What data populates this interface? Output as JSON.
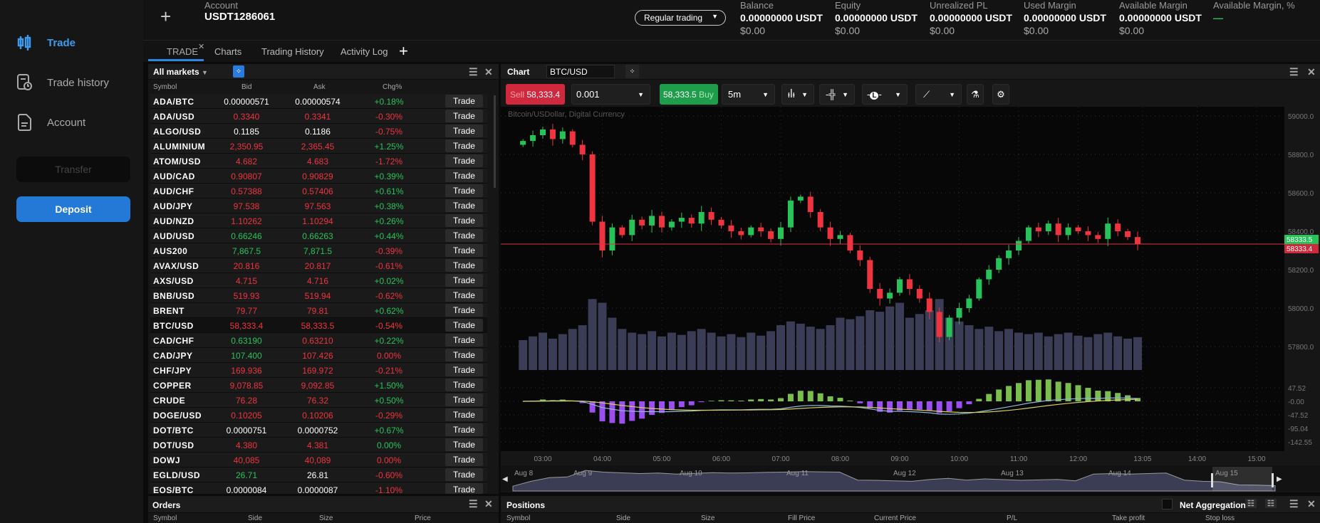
{
  "sidebar": {
    "items": [
      {
        "label": "Trade",
        "icon": "candlestick-icon",
        "active": true
      },
      {
        "label": "Trade history",
        "icon": "history-icon"
      },
      {
        "label": "Account",
        "icon": "document-icon"
      }
    ],
    "transfer": "Transfer",
    "deposit": "Deposit"
  },
  "header": {
    "account_label": "Account",
    "account_id": "USDT1286061",
    "mode": "Regular trading",
    "stats": [
      {
        "label": "Balance",
        "value": "0.00000000 USDT",
        "usd": "$0.00"
      },
      {
        "label": "Equity",
        "value": "0.00000000 USDT",
        "usd": "$0.00"
      },
      {
        "label": "Unrealized PL",
        "value": "0.00000000 USDT",
        "usd": "$0.00"
      },
      {
        "label": "Used Margin",
        "value": "0.00000000 USDT",
        "usd": "$0.00"
      },
      {
        "label": "Available Margin",
        "value": "0.00000000 USDT",
        "usd": "$0.00"
      },
      {
        "label": "Available Margin, %",
        "value": "—",
        "usd": ""
      }
    ]
  },
  "tabs": [
    "TRADE",
    "Charts",
    "Trading History",
    "Activity Log"
  ],
  "markets": {
    "title": "All markets",
    "columns": [
      "Symbol",
      "Bid",
      "Ask",
      "Chg%"
    ],
    "trade_label": "Trade",
    "rows": [
      [
        "ADA/BTC",
        "0.00000571",
        "0.00000574",
        "+0.18%",
        "wwg"
      ],
      [
        "ADA/USD",
        "0.3340",
        "0.3341",
        "-0.30%",
        "rrr"
      ],
      [
        "ALGO/USD",
        "0.1185",
        "0.1186",
        "-0.75%",
        "wwr"
      ],
      [
        "ALUMINIUM",
        "2,350.95",
        "2,365.45",
        "+1.25%",
        "rrg"
      ],
      [
        "ATOM/USD",
        "4.682",
        "4.683",
        "-1.72%",
        "rrr"
      ],
      [
        "AUD/CAD",
        "0.90807",
        "0.90829",
        "+0.39%",
        "rrg"
      ],
      [
        "AUD/CHF",
        "0.57388",
        "0.57406",
        "+0.61%",
        "rrg"
      ],
      [
        "AUD/JPY",
        "97.538",
        "97.563",
        "+0.38%",
        "rrg"
      ],
      [
        "AUD/NZD",
        "1.10262",
        "1.10294",
        "+0.26%",
        "rrg"
      ],
      [
        "AUD/USD",
        "0.66246",
        "0.66263",
        "+0.44%",
        "ggg"
      ],
      [
        "AUS200",
        "7,867.5",
        "7,871.5",
        "-0.39%",
        "ggr"
      ],
      [
        "AVAX/USD",
        "20.816",
        "20.817",
        "-0.61%",
        "rrr"
      ],
      [
        "AXS/USD",
        "4.715",
        "4.716",
        "+0.02%",
        "rrg"
      ],
      [
        "BNB/USD",
        "519.93",
        "519.94",
        "-0.62%",
        "rrr"
      ],
      [
        "BRENT",
        "79.77",
        "79.81",
        "+0.62%",
        "rrg"
      ],
      [
        "BTC/USD",
        "58,333.4",
        "58,333.5",
        "-0.54%",
        "rrr"
      ],
      [
        "CAD/CHF",
        "0.63190",
        "0.63210",
        "+0.22%",
        "grg"
      ],
      [
        "CAD/JPY",
        "107.400",
        "107.426",
        "0.00%",
        "grr"
      ],
      [
        "CHF/JPY",
        "169.936",
        "169.972",
        "-0.21%",
        "rrr"
      ],
      [
        "COPPER",
        "9,078.85",
        "9,092.85",
        "+1.50%",
        "rrg"
      ],
      [
        "CRUDE",
        "76.28",
        "76.32",
        "+0.50%",
        "rrg"
      ],
      [
        "DOGE/USD",
        "0.10205",
        "0.10206",
        "-0.29%",
        "rrr"
      ],
      [
        "DOT/BTC",
        "0.0000751",
        "0.0000752",
        "+0.67%",
        "wwg"
      ],
      [
        "DOT/USD",
        "4.380",
        "4.381",
        "0.00%",
        "rrg"
      ],
      [
        "DOWJ",
        "40,085",
        "40,089",
        "0.00%",
        "rrr"
      ],
      [
        "EGLD/USD",
        "26.71",
        "26.81",
        "-0.60%",
        "gwr"
      ],
      [
        "EOS/BTC",
        "0.0000084",
        "0.0000087",
        "-1.10%",
        "wwr"
      ]
    ]
  },
  "chart": {
    "title": "Chart",
    "symbol": "BTC/USD",
    "sell_label": "Sell",
    "sell_price": "58,333.4",
    "buy_price": "58,333.5",
    "buy_label": "Buy",
    "quantity": "0.001",
    "interval": "5m",
    "watermark": "Bitcoin/USDollar, Digital Currency"
  },
  "chart_data": {
    "type": "candlestick",
    "interval_of_values": "10m",
    "x_start": "02:40",
    "closes": [
      58870,
      58900,
      58930,
      58880,
      58920,
      58850,
      58800,
      58450,
      58300,
      58420,
      58380,
      58460,
      58430,
      58480,
      58420,
      58450,
      58470,
      58440,
      58500,
      58460,
      58430,
      58400,
      58380,
      58420,
      58400,
      58360,
      58420,
      58560,
      58580,
      58500,
      58420,
      58360,
      58380,
      58300,
      58250,
      58100,
      58050,
      58080,
      58150,
      58100,
      58050,
      57980,
      57850,
      57950,
      58000,
      58050,
      58150,
      58200,
      58260,
      58300,
      58350,
      58420,
      58400,
      58440,
      58380,
      58420,
      58400,
      58380,
      58360,
      58440,
      58400,
      58370,
      58333.4
    ],
    "volume": [
      40,
      45,
      50,
      42,
      48,
      55,
      60,
      95,
      90,
      70,
      55,
      50,
      48,
      52,
      45,
      50,
      47,
      52,
      55,
      50,
      45,
      48,
      44,
      50,
      46,
      52,
      60,
      65,
      62,
      58,
      55,
      60,
      70,
      68,
      72,
      80,
      78,
      85,
      90,
      70,
      75,
      80,
      95,
      70,
      65,
      60,
      55,
      58,
      52,
      55,
      50,
      48,
      50,
      45,
      48,
      50,
      46,
      44,
      48,
      50,
      45,
      42,
      44
    ],
    "y_ticks": [
      "59000.0",
      "58800.0",
      "58600.0",
      "58400.0",
      "58200.0",
      "58000.0",
      "57800.0"
    ],
    "ylim": [
      57740,
      59040
    ],
    "bid_label": "58333.5",
    "ask_label": "58333.4",
    "macd_ticks": [
      "47.52",
      "-0.00",
      "-47.52",
      "-95.04",
      "-142.55"
    ],
    "x_ticks": [
      "03:00",
      "04:00",
      "05:00",
      "06:00",
      "07:00",
      "08:00",
      "09:00",
      "10:00",
      "11:00",
      "12:00",
      "13:05",
      "14:00",
      "15:00"
    ],
    "navigator_labels": [
      "Aug 8",
      "Aug 9",
      "Aug 10",
      "Aug 11",
      "Aug 12",
      "Aug 13",
      "Aug 14",
      "Aug 15"
    ],
    "navigator_values": [
      20,
      40,
      55,
      58,
      85,
      78,
      75,
      72,
      74,
      70,
      73,
      76,
      74,
      75,
      77,
      78,
      80,
      79,
      78,
      45,
      44,
      42,
      40,
      48,
      52,
      45,
      50,
      47,
      44,
      46,
      48,
      42,
      70,
      72,
      70,
      72,
      74,
      45,
      40,
      38,
      25,
      24,
      22
    ],
    "colors": {
      "up": "#27c35a",
      "down": "#f0343f",
      "volume": "#3a3d55",
      "macd_line": "#8fb8e0",
      "signal_line": "#d8cf5a",
      "hist_up": "#7bbd4f",
      "hist_down": "#9b4ff0"
    }
  },
  "orders": {
    "title": "Orders",
    "columns": [
      "Symbol",
      "Side",
      "Size",
      "Price"
    ]
  },
  "positions": {
    "title": "Positions",
    "net_aggregation": "Net Aggregation",
    "columns": [
      "Symbol",
      "Side",
      "Size",
      "Fill Price",
      "Current Price",
      "P/L",
      "Take profit",
      "Stop loss"
    ]
  }
}
